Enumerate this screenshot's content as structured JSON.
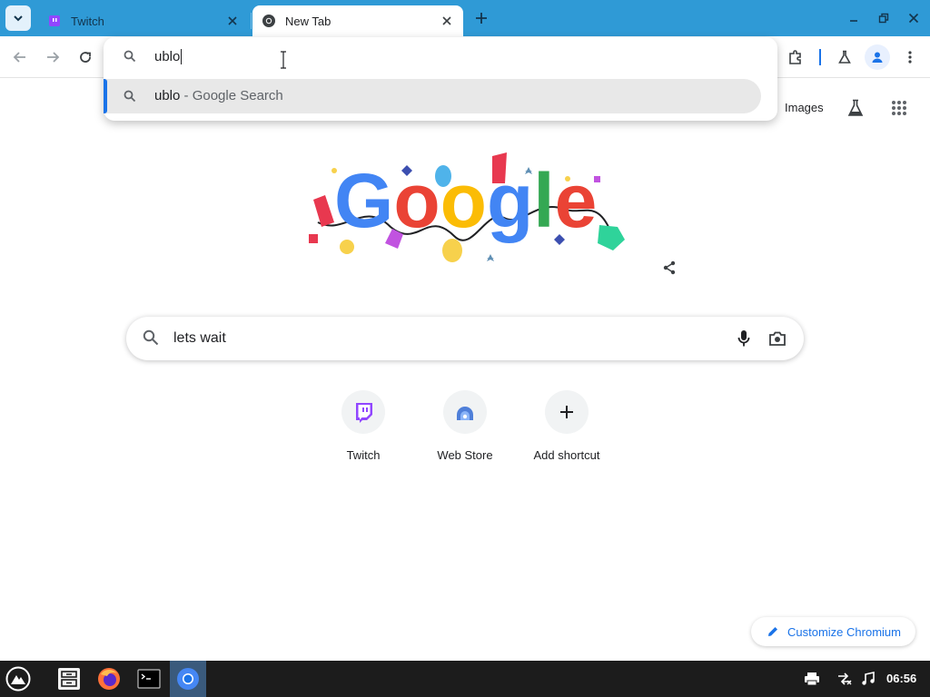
{
  "colors": {
    "tabstrip": "#2f9ad6",
    "accent": "#1a73e8",
    "taskbar": "#1c1c1c",
    "twitch": "#9146ff"
  },
  "tabs": [
    {
      "title": "Twitch",
      "favicon": "twitch-icon",
      "active": false
    },
    {
      "title": "New Tab",
      "favicon": "chromium-icon",
      "active": true
    }
  ],
  "omnibox": {
    "typed": "ublo",
    "suggestion": {
      "query": "ublo",
      "suffix": " - Google Search"
    }
  },
  "ntp": {
    "images_link": "Images",
    "search_text": "lets wait",
    "shortcuts": [
      {
        "label": "Twitch",
        "icon": "twitch-icon"
      },
      {
        "label": "Web Store",
        "icon": "webstore-icon"
      },
      {
        "label": "Add shortcut",
        "icon": "plus-icon"
      }
    ],
    "customize_label": "Customize Chromium",
    "doodle_text": "Google"
  },
  "taskbar": {
    "apps": [
      "launcher-icon",
      "file-manager-icon",
      "firefox-icon",
      "terminal-icon",
      "chromium-icon"
    ],
    "clock": "06:56"
  }
}
